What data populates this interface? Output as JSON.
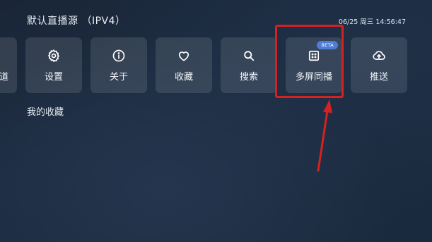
{
  "header": {
    "title": "默认直播源 （IPV4）",
    "status": "06/25 周三 14:56:47"
  },
  "menu": {
    "partial_label": "道",
    "items": [
      {
        "label": "设置",
        "icon": "gear-icon"
      },
      {
        "label": "关于",
        "icon": "info-icon"
      },
      {
        "label": "收藏",
        "icon": "heart-icon"
      },
      {
        "label": "搜索",
        "icon": "search-icon"
      },
      {
        "label": "多屏同播",
        "icon": "grid-icon",
        "badge": "BETA"
      },
      {
        "label": "推送",
        "icon": "cloud-upload-icon"
      }
    ]
  },
  "favorites": {
    "title": "我的收藏"
  },
  "annotation": {
    "color": "#d32222"
  }
}
